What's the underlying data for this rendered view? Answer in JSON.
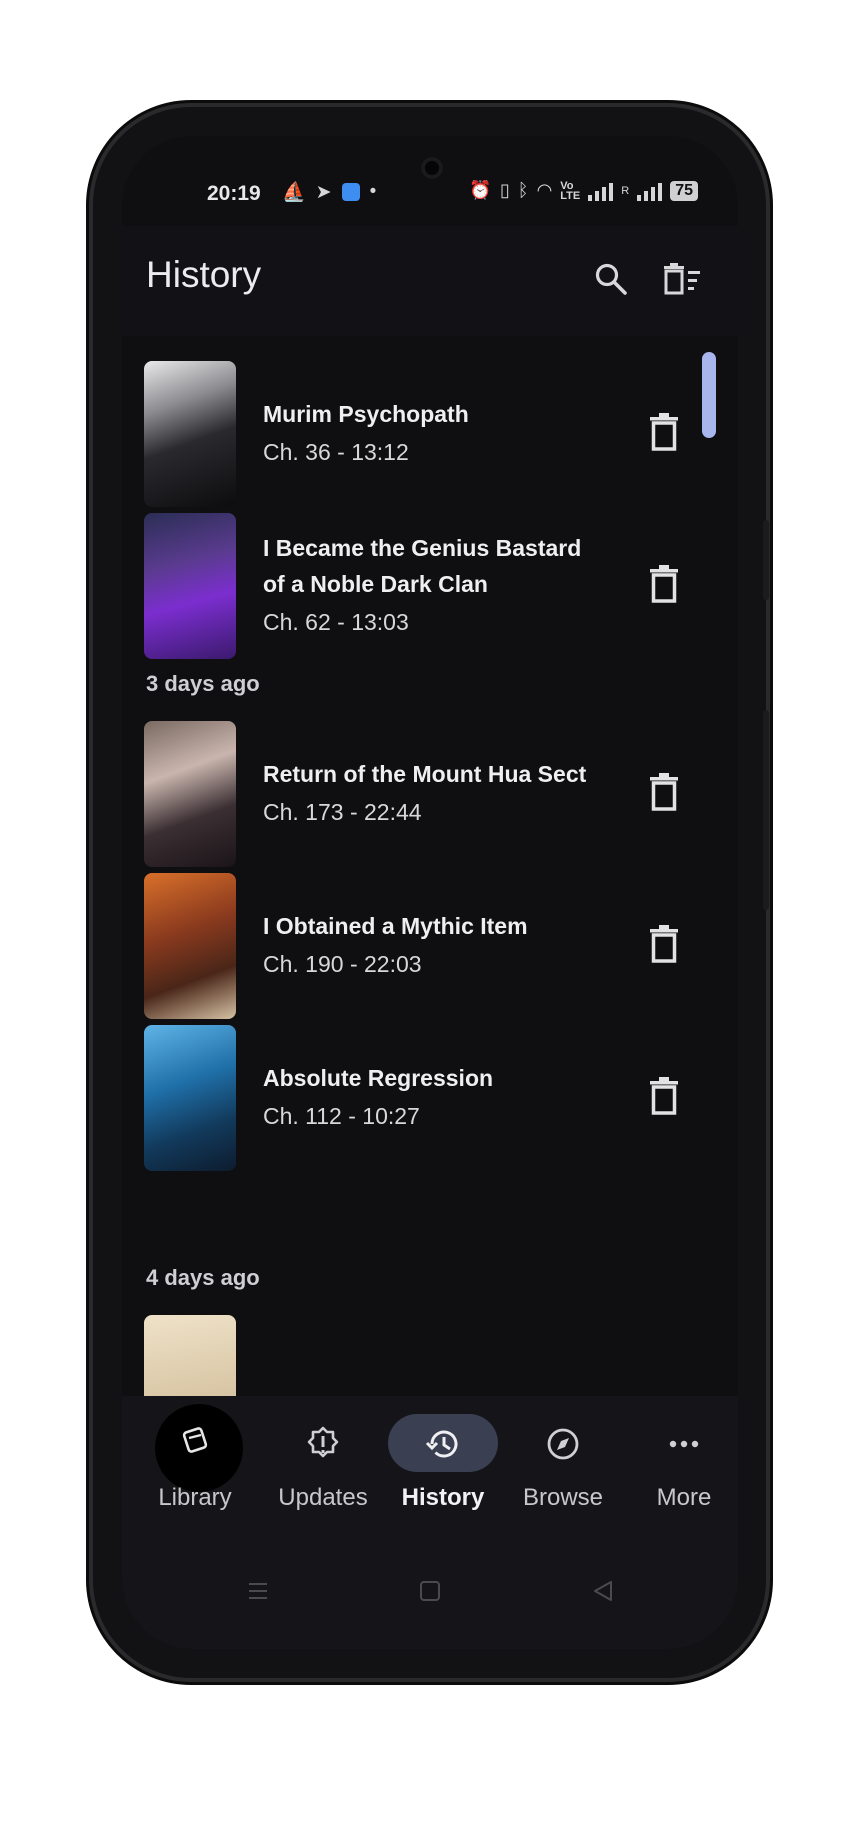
{
  "status_bar": {
    "time": "20:19",
    "battery": "75",
    "signal_label": "R",
    "volte_label": "Vo\nLTE"
  },
  "top_bar": {
    "title": "History"
  },
  "history": {
    "items_a": [
      {
        "title": "Murim Psychopath",
        "subtitle": "Ch. 36 - 13:12"
      },
      {
        "title": "I Became the Genius Bastard of a Noble Dark Clan",
        "subtitle": "Ch. 62 - 13:03"
      }
    ],
    "header_1": "3 days ago",
    "items_b": [
      {
        "title": "Return of the Mount Hua Sect",
        "subtitle": "Ch. 173 - 22:44"
      },
      {
        "title": "I Obtained a Mythic Item",
        "subtitle": "Ch. 190 - 22:03"
      },
      {
        "title": "Absolute Regression",
        "subtitle": "Ch. 112 - 10:27"
      }
    ],
    "header_2": "4 days ago"
  },
  "bottom_nav": {
    "items": [
      {
        "label": "Library",
        "icon": "library-icon"
      },
      {
        "label": "Updates",
        "icon": "updates-icon"
      },
      {
        "label": "History",
        "icon": "history-icon"
      },
      {
        "label": "Browse",
        "icon": "browse-icon"
      },
      {
        "label": "More",
        "icon": "more-icon"
      }
    ],
    "active": "History"
  },
  "colors": {
    "background": "#0f0f12",
    "accent": "#a9b6ee",
    "active_pill": "#3a3f52"
  }
}
